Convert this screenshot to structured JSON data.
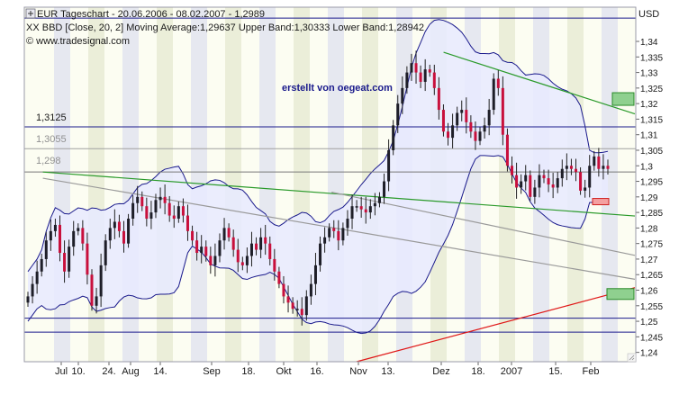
{
  "header": {
    "line1": "EUR Tageschart - 20.06.2006 - 08.02.2007 - 1,2989",
    "line2": "XX BBD [Close, 20, 2] Moving Average:1,29637 Upper Band:1,30333 Lower Band:1,28942",
    "line3": "© www.tradesignal.com"
  },
  "watermark": "erstellt von oegeat.com",
  "axis": {
    "currency": "USD",
    "y_ticks": [
      "1,34",
      "1,335",
      "1,33",
      "1,325",
      "1,32",
      "1,315",
      "1,31",
      "1,305",
      "1,3",
      "1,295",
      "1,29",
      "1,285",
      "1,28",
      "1,275",
      "1,27",
      "1,265",
      "1,26",
      "1,255",
      "1,25",
      "1,245",
      "1,24"
    ],
    "x_ticks": [
      "Jul",
      "10.",
      "24.",
      "Aug",
      "14.",
      "Sep",
      "18.",
      "Okt",
      "16.",
      "Nov",
      "13.",
      "Dez",
      "18.",
      "2007",
      "15.",
      "Feb"
    ]
  },
  "levels": [
    {
      "label": "1,3125",
      "value": 1.3125
    },
    {
      "label": "1,3055",
      "value": 1.3055
    },
    {
      "label": "1,298",
      "value": 1.298
    }
  ],
  "colors": {
    "candle_up": "#1e1e28",
    "candle_down": "#c8103c",
    "band": "#1a1a8c",
    "band_fill": "#e8eaff",
    "level_line": "#1a1a8c",
    "trend_green": "#2a9a2a",
    "trend_red": "#e01818",
    "trend_gray": "#9a9a9a",
    "watermark": "#1a1a8c"
  },
  "chart_data": {
    "type": "candlestick",
    "title": "EUR Tageschart - 20.06.2006 - 08.02.2007 - 1,2989",
    "ylabel": "USD",
    "ylim": [
      1.237,
      1.351
    ],
    "date_range": [
      "20.06.2006",
      "08.02.2007"
    ],
    "last_close": 1.2989,
    "indicator": {
      "name": "XX BBD [Close, 20, 2]",
      "moving_average": 1.29637,
      "upper_band": 1.30333,
      "lower_band": 1.28942
    },
    "close_series": [
      1.258,
      1.262,
      1.266,
      1.27,
      1.276,
      1.279,
      1.281,
      1.272,
      1.266,
      1.274,
      1.279,
      1.28,
      1.275,
      1.265,
      1.255,
      1.258,
      1.268,
      1.276,
      1.28,
      1.282,
      1.279,
      1.275,
      1.283,
      1.288,
      1.29,
      1.287,
      1.283,
      1.285,
      1.289,
      1.29,
      1.288,
      1.284,
      1.283,
      1.287,
      1.284,
      1.279,
      1.276,
      1.272,
      1.274,
      1.271,
      1.268,
      1.271,
      1.276,
      1.28,
      1.277,
      1.273,
      1.269,
      1.268,
      1.271,
      1.275,
      1.273,
      1.277,
      1.275,
      1.27,
      1.266,
      1.262,
      1.258,
      1.256,
      1.254,
      1.254,
      1.252,
      1.258,
      1.262,
      1.268,
      1.275,
      1.277,
      1.28,
      1.279,
      1.276,
      1.28,
      1.283,
      1.287,
      1.287,
      1.286,
      1.285,
      1.287,
      1.288,
      1.29,
      1.295,
      1.305,
      1.313,
      1.32,
      1.325,
      1.33,
      1.333,
      1.33,
      1.327,
      1.331,
      1.33,
      1.325,
      1.318,
      1.311,
      1.309,
      1.313,
      1.317,
      1.318,
      1.314,
      1.311,
      1.308,
      1.311,
      1.313,
      1.318,
      1.328,
      1.325,
      1.31,
      1.3,
      1.297,
      1.293,
      1.295,
      1.297,
      1.29,
      1.293,
      1.297,
      1.296,
      1.294,
      1.293,
      1.296,
      1.299,
      1.3,
      1.299,
      1.298,
      1.292,
      1.293,
      1.3,
      1.303,
      1.299,
      1.3,
      1.299
    ],
    "series": [
      {
        "name": "Moving Average",
        "last": 1.29637
      },
      {
        "name": "Upper Band",
        "last": 1.30333
      },
      {
        "name": "Lower Band",
        "last": 1.28942
      }
    ],
    "horizontal_lines": [
      1.3125,
      1.3055,
      1.298,
      1.251,
      1.2465,
      1.3475
    ],
    "trendlines": [
      {
        "color": "green",
        "from": [
          "26.06.2006",
          1.298
        ],
        "to": [
          "08.02.2007",
          1.2845
        ]
      },
      {
        "color": "gray",
        "from": [
          "26.06.2006",
          1.296
        ],
        "to": [
          "08.02.2007",
          1.265
        ]
      },
      {
        "color": "gray",
        "from": [
          "20.10.2006",
          1.2915
        ],
        "to": [
          "08.02.2007",
          1.273
        ]
      },
      {
        "color": "green",
        "from": [
          "04.12.2006",
          1.3365
        ],
        "to": [
          "08.02.2007",
          1.3195
        ]
      },
      {
        "color": "red",
        "from": [
          "30.10.2006",
          1.237
        ],
        "to": [
          "08.02.2007",
          1.2585
        ]
      }
    ]
  }
}
